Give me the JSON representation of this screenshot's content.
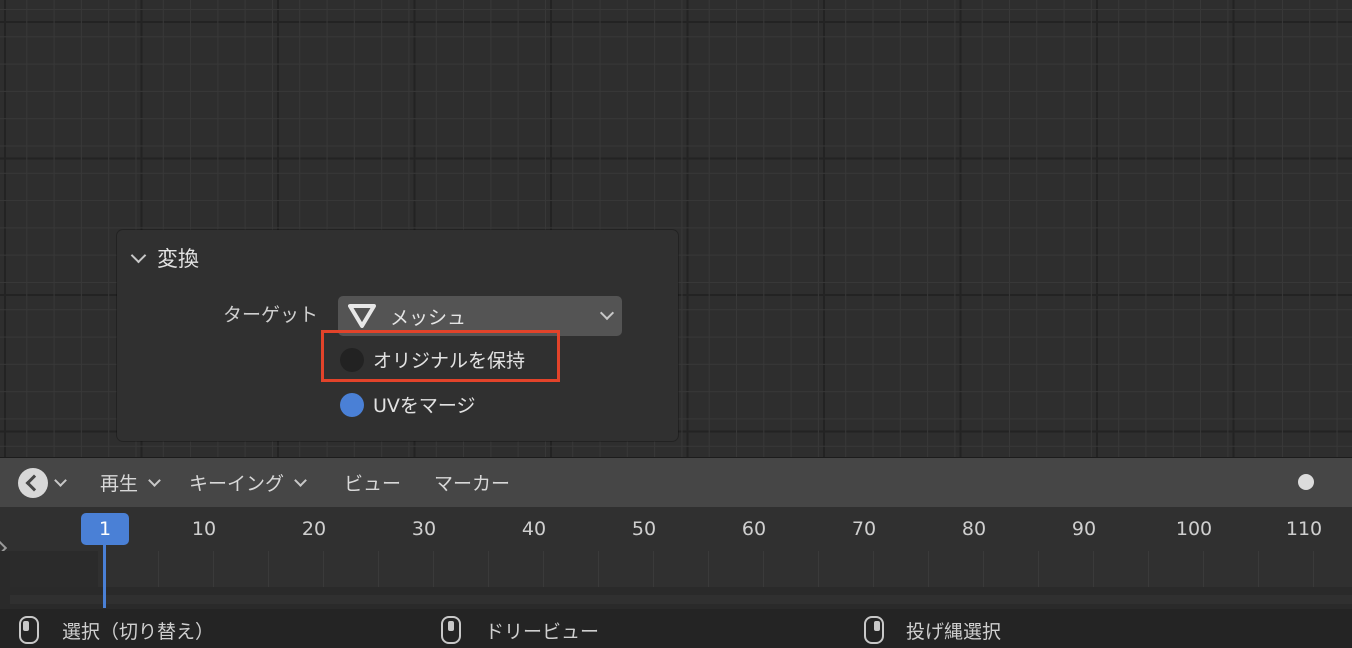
{
  "panel": {
    "title": "変換",
    "target_label": "ターゲット",
    "target_value": "メッシュ",
    "options": [
      {
        "label": "オリジナルを保持",
        "checked": false
      },
      {
        "label": "UVをマージ",
        "checked": true
      }
    ],
    "highlight_color": "#e2432a"
  },
  "timeline": {
    "editor_icon": "clock-icon",
    "menus": [
      "再生",
      "キーイング",
      "ビュー",
      "マーカー"
    ],
    "current_frame": "1",
    "frame_ticks": [
      "10",
      "20",
      "30",
      "40",
      "50",
      "60",
      "70",
      "80",
      "90",
      "100",
      "110"
    ],
    "accent_color": "#4a80d6"
  },
  "statusbar": {
    "hints": [
      {
        "icon": "mouse-left-icon",
        "label": "選択（切り替え）"
      },
      {
        "icon": "mouse-middle-icon",
        "label": "ドリービュー"
      },
      {
        "icon": "mouse-right-icon",
        "label": "投げ縄選択"
      }
    ]
  }
}
